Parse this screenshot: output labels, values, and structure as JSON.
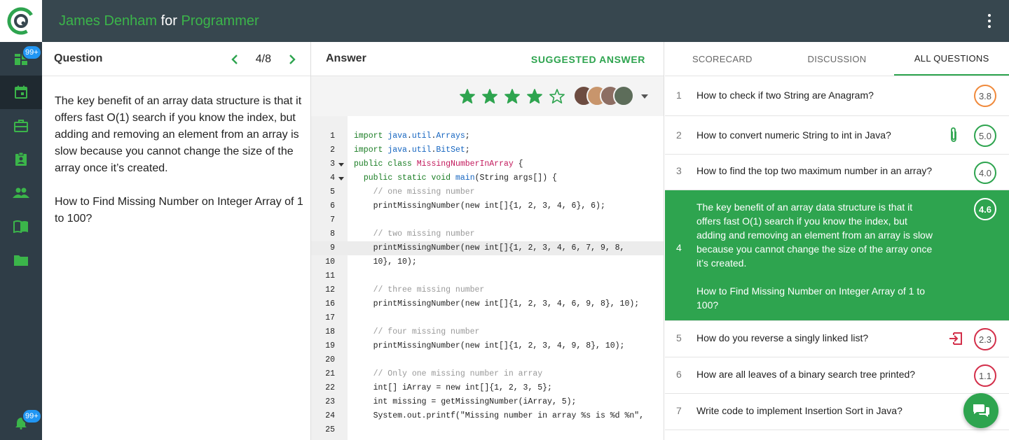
{
  "header": {
    "name": "James Denham",
    "connector": "for",
    "role": "Programmer"
  },
  "sidebar": {
    "badge_top": "99+",
    "badge_bottom": "99+"
  },
  "question": {
    "label": "Question",
    "pager": "4/8",
    "paragraph1": "The key benefit of an array data structure is that it offers fast O(1) search if you know the index, but adding and removing an element from an array is slow because you cannot change the size of the array once it’s created.",
    "paragraph2": "How to Find Missing Number on Integer Array of 1 to 100?"
  },
  "answer": {
    "label": "Answer",
    "suggested": "SUGGESTED ANSWER",
    "rating": 4,
    "rating_max": 5
  },
  "code": {
    "lines": [
      {
        "n": "1",
        "fold": false,
        "text": "import java.util.Arrays;"
      },
      {
        "n": "2",
        "fold": false,
        "text": "import java.util.BitSet;"
      },
      {
        "n": "3",
        "fold": true,
        "text": "public class MissingNumberInArray {"
      },
      {
        "n": "4",
        "fold": true,
        "text": "  public static void main(String args[]) {"
      },
      {
        "n": "5",
        "fold": false,
        "text": "    // one missing number"
      },
      {
        "n": "6",
        "fold": false,
        "text": "    printMissingNumber(new int[]{1, 2, 3, 4, 6}, 6);"
      },
      {
        "n": "7",
        "fold": false,
        "text": ""
      },
      {
        "n": "8",
        "fold": false,
        "text": "    // two missing number"
      },
      {
        "n": "9",
        "fold": false,
        "text": "    printMissingNumber(new int[]{1, 2, 3, 4, 6, 7, 9, 8,"
      },
      {
        "n": "10",
        "fold": false,
        "text": "    10}, 10);"
      },
      {
        "n": "11",
        "fold": false,
        "text": ""
      },
      {
        "n": "12",
        "fold": false,
        "text": "    // three missing number"
      },
      {
        "n": "16",
        "fold": false,
        "text": "    printMissingNumber(new int[]{1, 2, 3, 4, 6, 9, 8}, 10);"
      },
      {
        "n": "17",
        "fold": false,
        "text": ""
      },
      {
        "n": "18",
        "fold": false,
        "text": "    // four missing number"
      },
      {
        "n": "19",
        "fold": false,
        "text": "    printMissingNumber(new int[]{1, 2, 3, 4, 9, 8}, 10);"
      },
      {
        "n": "20",
        "fold": false,
        "text": ""
      },
      {
        "n": "21",
        "fold": false,
        "text": "    // Only one missing number in array"
      },
      {
        "n": "22",
        "fold": false,
        "text": "    int[] iArray = new int[]{1, 2, 3, 5};"
      },
      {
        "n": "23",
        "fold": false,
        "text": "    int missing = getMissingNumber(iArray, 5);"
      },
      {
        "n": "24",
        "fold": false,
        "text": "    System.out.printf(\"Missing number in array %s is %d %n\","
      },
      {
        "n": "25",
        "fold": false,
        "text": ""
      }
    ],
    "highlight_line": "9"
  },
  "tabs": [
    "SCORECARD",
    "DISCUSSION",
    "ALL QUESTIONS"
  ],
  "active_tab": 2,
  "questions": [
    {
      "n": "1",
      "text": "How to check if two String are Anagram?",
      "score": "3.8",
      "color": "#f08a3c",
      "icon": ""
    },
    {
      "n": "2",
      "text": "How to convert numeric String to int in Java?",
      "score": "5.0",
      "color": "#2ea44f",
      "icon": "paperclip-icon"
    },
    {
      "n": "3",
      "text": "How to find the top two maximum number in an array?",
      "score": "4.0",
      "color": "#2ea44f",
      "icon": ""
    },
    {
      "n": "4",
      "text": "The key benefit of an array data structure is that it offers fast O(1) search if you know the index, but adding and removing an element from an array is slow because you cannot change the size of the array once it’s created.",
      "text2": "How to Find Missing Number on Integer Array of 1 to 100?",
      "score": "4.6",
      "color": "#ffffff",
      "icon": "",
      "selected": true
    },
    {
      "n": "5",
      "text": "How do you reverse a singly linked list?",
      "score": "2.3",
      "color": "#d32f4a",
      "icon": "exit-icon"
    },
    {
      "n": "6",
      "text": "How are all leaves of a binary search tree printed?",
      "score": "1.1",
      "color": "#d32f4a",
      "icon": ""
    },
    {
      "n": "7",
      "text": "Write code to implement Insertion Sort in Java?",
      "score": "",
      "color": "#2ea44f",
      "icon": ""
    }
  ],
  "colors": {
    "brand": "#2ea44f",
    "topbar": "#37474f",
    "sidebar": "#2f3d47",
    "badge": "#2196f3"
  }
}
